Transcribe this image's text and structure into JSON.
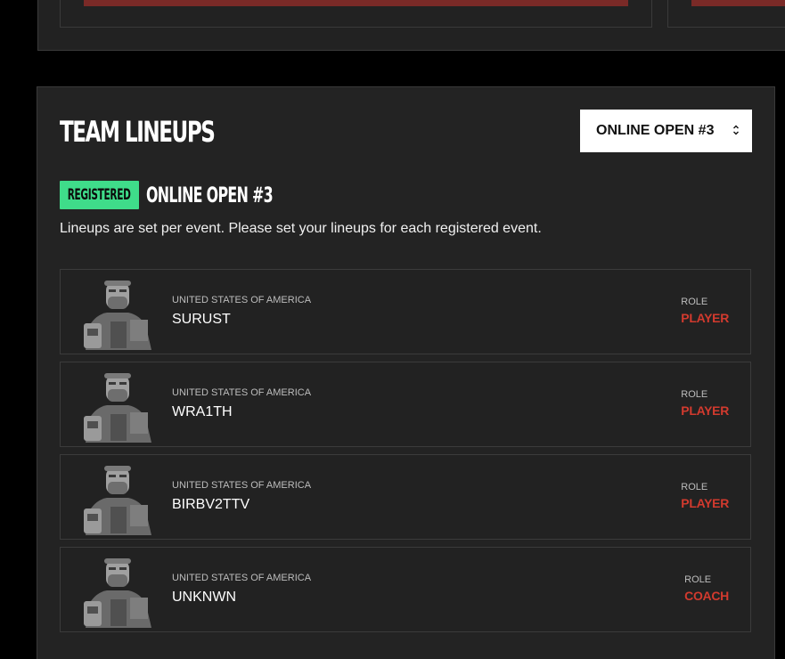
{
  "section": {
    "title": "TEAM LINEUPS",
    "event_select": {
      "selected": "ONLINE OPEN #3"
    },
    "status": {
      "badge": "REGISTERED",
      "event_name": "ONLINE OPEN #3"
    },
    "description": "Lineups are set per event. Please set your lineups for each registered event."
  },
  "colors": {
    "accent_green": "#3fdc8a",
    "role_red": "#d23a2e",
    "panel_bg": "#232323",
    "top_bar_red": "#7a2a27"
  },
  "players": [
    {
      "country": "UNITED STATES OF AMERICA",
      "name": "SURUST",
      "role_label": "ROLE",
      "role": "PLAYER"
    },
    {
      "country": "UNITED STATES OF AMERICA",
      "name": "WRA1TH",
      "role_label": "ROLE",
      "role": "PLAYER"
    },
    {
      "country": "UNITED STATES OF AMERICA",
      "name": "BIRBV2TTV",
      "role_label": "ROLE",
      "role": "PLAYER"
    },
    {
      "country": "UNITED STATES OF AMERICA",
      "name": "UNKNWN",
      "role_label": "ROLE",
      "role": "COACH"
    }
  ],
  "icons": {
    "select": "chevron-up-down-icon",
    "avatar": "player-avatar"
  }
}
